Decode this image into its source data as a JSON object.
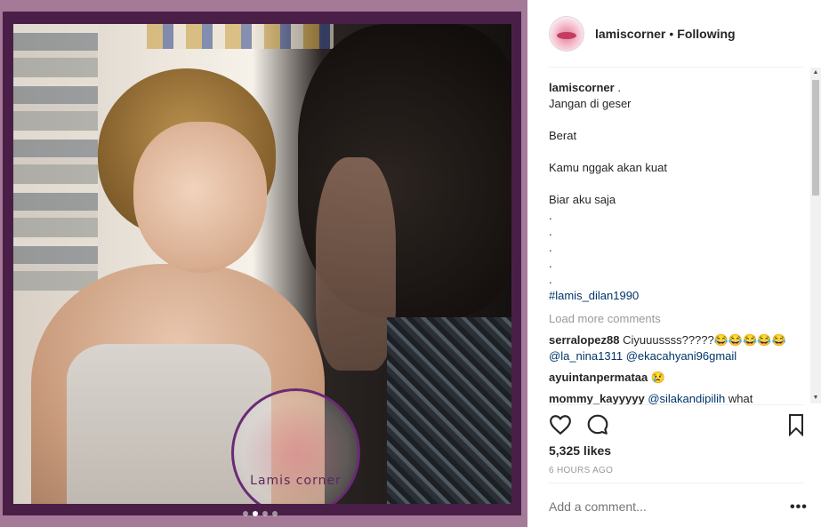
{
  "post": {
    "watermark_text": "Lamis corner",
    "carousel": {
      "count": 4,
      "active_index": 1
    }
  },
  "header": {
    "username": "lamiscorner",
    "separator": "•",
    "follow_status": "Following"
  },
  "caption": {
    "username": "lamiscorner",
    "username_suffix": " .",
    "lines": [
      "Jangan di geser",
      "",
      "Berat",
      "",
      "Kamu nggak akan kuat",
      "",
      "Biar aku saja",
      ".",
      ".",
      ".",
      ".",
      "."
    ],
    "hashtag": "#lamis_dilan1990"
  },
  "load_more": "Load more comments",
  "comments": [
    {
      "user": "serralopez88",
      "text": "Ciyuuussss?????😂😂😂😂😂",
      "mentions": [
        "@la_nina1311",
        "@ekacahyani96gmail"
      ]
    },
    {
      "user": "ayuintanpermataa",
      "text": "😢",
      "mentions": []
    },
    {
      "user": "mommy_kayyyyy",
      "text": "what",
      "mentions": [
        "@silakandipilih"
      ]
    }
  ],
  "actions": {
    "like_icon": "heart-icon",
    "comment_icon": "speech-bubble-icon",
    "save_icon": "bookmark-icon"
  },
  "likes": "5,325 likes",
  "time": "6 HOURS AGO",
  "add_comment": {
    "placeholder": "Add a comment..."
  },
  "more": "•••",
  "scroll": {
    "up": "▲",
    "down": "▼"
  },
  "colors": {
    "frame": "#4a1f47",
    "background": "#a57a98",
    "link": "#003569",
    "muted": "#999999"
  }
}
